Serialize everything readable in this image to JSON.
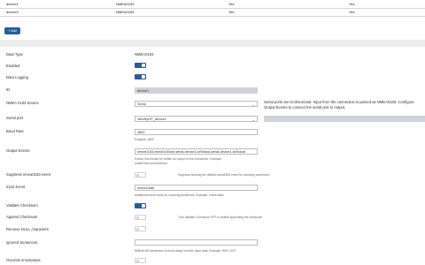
{
  "table": {
    "rows": [
      {
        "name": "device1",
        "type": "NMEA0183",
        "enabled": "Yes",
        "logging": "Yes"
      },
      {
        "name": "device2",
        "type": "NMEA0183",
        "enabled": "Yes",
        "logging": "Yes"
      }
    ]
  },
  "add_button": {
    "label": "Add",
    "icon": "plus-icon"
  },
  "form": {
    "data_type": {
      "label": "Data Type",
      "value": "NMEA0183"
    },
    "enabled": {
      "label": "Enabled",
      "state": "on"
    },
    "data_logging": {
      "label": "Data Logging",
      "state": "on"
    },
    "id": {
      "label": "ID",
      "value": "device1"
    },
    "source": {
      "label": "NMEA 0183 Source",
      "value": "Serial",
      "note": "Serial ports are bi-directional. Input from the connection is parsed as NMEA0183. Configure Output Events to connect the serial port to output."
    },
    "serial_port": {
      "label": "Serial port",
      "value": "/dev/ttyOP_device1"
    },
    "baud_rate": {
      "label": "Baud Rate",
      "value": "4800",
      "help": "Example: 4800"
    },
    "output_events": {
      "label": "Output Events",
      "value": "nmea0183,nmea0183out,serial-device1-toStdout,serial-device1-toStdout",
      "help": "Events that should be written as output to this connection. Example:",
      "help2": "nmea0183,nmea0183out"
    },
    "suppress": {
      "label": "Suppress nmea0183 event",
      "state": "off",
      "help": "Suppress sending the default nmea0183 event for incoming sentences"
    },
    "input_event": {
      "label": "Input Event",
      "value": "nmea1data",
      "help": "Additional event name for incoming sentences. Example: nmea1data"
    },
    "validate_checksum": {
      "label": "Validate Checksum",
      "state": "on"
    },
    "append_checksum": {
      "label": "Append Checksum",
      "state": "off",
      "help": "Turn Validate Checksum OFF to enable appending the checksum"
    },
    "remove_null": {
      "label": "Remove NULL characters",
      "state": "off"
    },
    "ignored_sentences": {
      "label": "Ignored Sentences",
      "value": "",
      "help": "NMEA0183 sentences to throw away from the input data. Example: RMC,GGT"
    },
    "override_timestamps": {
      "label": "Override timestamps",
      "state": "off"
    }
  },
  "colors": {
    "accent": "#2b5d99",
    "readonly_field": "#cfd3d8",
    "band": "#ececec"
  }
}
